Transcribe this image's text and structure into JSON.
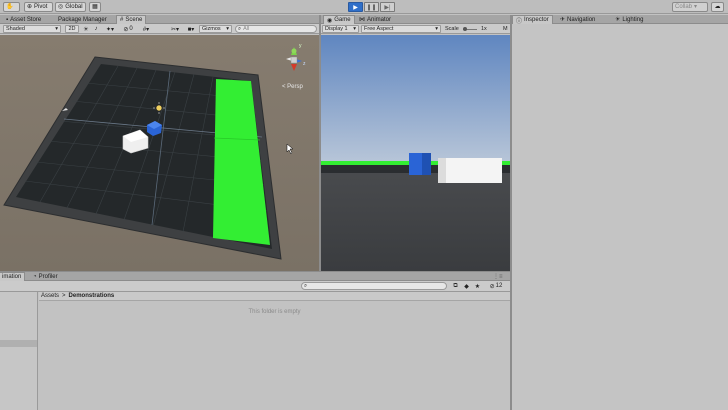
{
  "toolbar": {
    "pivot_label": "Pivot",
    "global_label": "Global",
    "collab_label": "Collab",
    "colors": {
      "play_active": "#2f6fc9"
    }
  },
  "scene_tabs": {
    "asset_store": "Asset Store",
    "package_manager": "Package Manager",
    "scene": "Scene"
  },
  "scene_toolbar": {
    "shading_mode": "Shaded",
    "mode_2d": "2D",
    "audio_count": "0",
    "gizmos_label": "Gizmos",
    "search_placeholder": "All",
    "gizmo_persp_label": "< Persp",
    "axis_y": "y",
    "axis_z": "z"
  },
  "game_tabs": {
    "game": "Game",
    "animator": "Animator"
  },
  "game_toolbar": {
    "display": "Display 1",
    "aspect": "Free Aspect",
    "scale_label": "Scale",
    "scale_value": "1x",
    "maximize": "M"
  },
  "inspector_tabs": {
    "inspector": "Inspector",
    "navigation": "Navigation",
    "lighting": "Lighting"
  },
  "bottom_tabs": {
    "animation": "imation",
    "profiler": "Profiler"
  },
  "project": {
    "path_root": "Assets",
    "path_sep": ">",
    "path_folder": "Demonstrations",
    "empty_message": "This folder is empty",
    "icon_count": "12"
  },
  "colors": {
    "scene_bg": "#7d7468",
    "floor": "#262a2c",
    "wall": "#3a3c3e",
    "green_zone": "#33ee33",
    "sky_top": "#5f86c0",
    "sky_bottom": "#b7c5d8",
    "ground": "#3f4245",
    "cube_blue": "#2a64d6",
    "cube_white": "#f4f4f4"
  }
}
